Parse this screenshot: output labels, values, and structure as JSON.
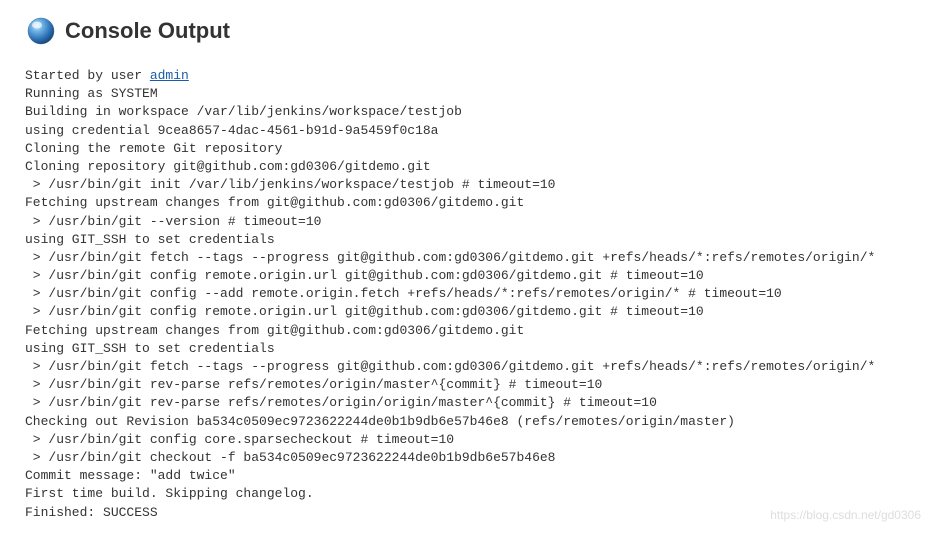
{
  "header": {
    "title": "Console Output"
  },
  "log": {
    "line0_prefix": "Started by user ",
    "line0_link": "admin",
    "lines": [
      "Running as SYSTEM",
      "Building in workspace /var/lib/jenkins/workspace/testjob",
      "using credential 9cea8657-4dac-4561-b91d-9a5459f0c18a",
      "Cloning the remote Git repository",
      "Cloning repository git@github.com:gd0306/gitdemo.git",
      " > /usr/bin/git init /var/lib/jenkins/workspace/testjob # timeout=10",
      "Fetching upstream changes from git@github.com:gd0306/gitdemo.git",
      " > /usr/bin/git --version # timeout=10",
      "using GIT_SSH to set credentials ",
      " > /usr/bin/git fetch --tags --progress git@github.com:gd0306/gitdemo.git +refs/heads/*:refs/remotes/origin/*",
      " > /usr/bin/git config remote.origin.url git@github.com:gd0306/gitdemo.git # timeout=10",
      " > /usr/bin/git config --add remote.origin.fetch +refs/heads/*:refs/remotes/origin/* # timeout=10",
      " > /usr/bin/git config remote.origin.url git@github.com:gd0306/gitdemo.git # timeout=10",
      "Fetching upstream changes from git@github.com:gd0306/gitdemo.git",
      "using GIT_SSH to set credentials ",
      " > /usr/bin/git fetch --tags --progress git@github.com:gd0306/gitdemo.git +refs/heads/*:refs/remotes/origin/*",
      " > /usr/bin/git rev-parse refs/remotes/origin/master^{commit} # timeout=10",
      " > /usr/bin/git rev-parse refs/remotes/origin/origin/master^{commit} # timeout=10",
      "Checking out Revision ba534c0509ec9723622244de0b1b9db6e57b46e8 (refs/remotes/origin/master)",
      " > /usr/bin/git config core.sparsecheckout # timeout=10",
      " > /usr/bin/git checkout -f ba534c0509ec9723622244de0b1b9db6e57b46e8",
      "Commit message: \"add twice\"",
      "First time build. Skipping changelog.",
      "Finished: SUCCESS"
    ]
  },
  "watermark": "https://blog.csdn.net/gd0306"
}
